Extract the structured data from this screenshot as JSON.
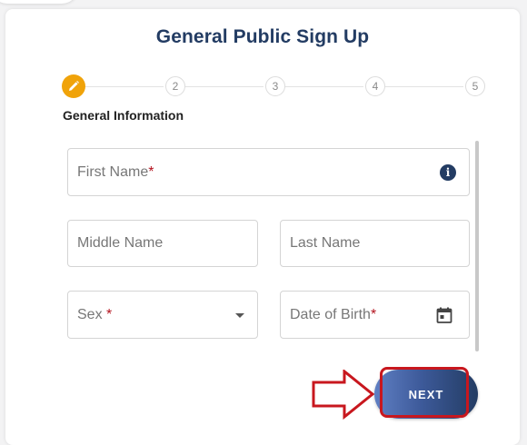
{
  "title": "General Public Sign Up",
  "stepper": {
    "steps": [
      "2",
      "3",
      "4",
      "5"
    ],
    "active_icon": "pencil-icon",
    "active_color": "#f0a30a"
  },
  "section_title": "General Information",
  "fields": {
    "first_name": {
      "label": "First Name",
      "required_mark": "*"
    },
    "middle_name": {
      "label": "Middle Name"
    },
    "last_name": {
      "label": "Last Name"
    },
    "sex": {
      "label": "Sex",
      "required_mark": " *"
    },
    "date_of_birth": {
      "label": "Date of Birth",
      "required_mark": "*"
    }
  },
  "icons": {
    "info": "info-icon",
    "dropdown": "chevron-down-icon",
    "calendar": "calendar-icon",
    "arrow": "arrow-right-icon"
  },
  "info_glyph": "i",
  "next_button": {
    "label": "NEXT"
  },
  "colors": {
    "primary": "#233c63",
    "required": "#b3121d",
    "highlight": "#c8171e"
  }
}
